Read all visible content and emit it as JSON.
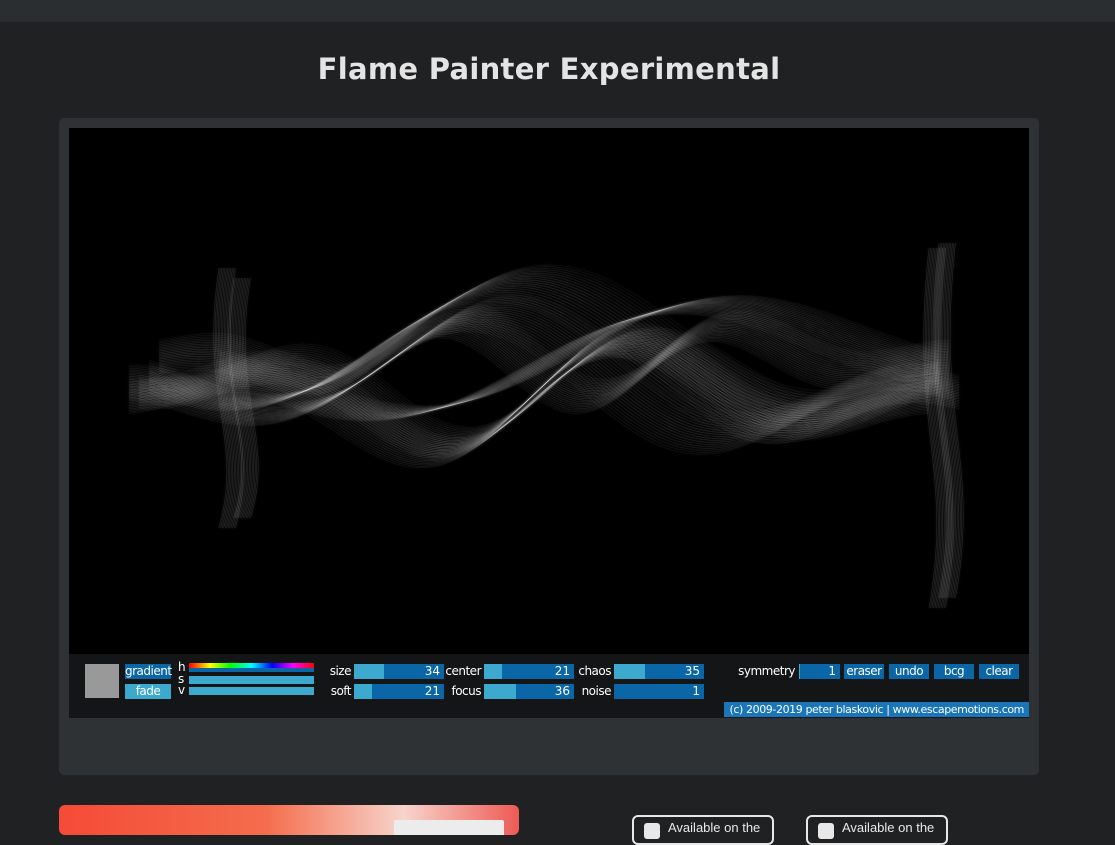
{
  "page": {
    "title": "Flame Painter Experimental"
  },
  "toolbar": {
    "color_swatch": "#999999",
    "gradient_label": "gradient",
    "fade_label": "fade",
    "hsv_labels": {
      "h": "h",
      "s": "s",
      "v": "v"
    },
    "sliders": {
      "size": {
        "label": "size",
        "value": "34",
        "fraction": 0.33
      },
      "soft": {
        "label": "soft",
        "value": "21",
        "fraction": 0.2
      },
      "center": {
        "label": "center",
        "value": "21",
        "fraction": 0.2
      },
      "focus": {
        "label": "focus",
        "value": "36",
        "fraction": 0.35
      },
      "chaos": {
        "label": "chaos",
        "value": "35",
        "fraction": 0.34
      },
      "noise": {
        "label": "noise",
        "value": "1",
        "fraction": 0.0
      }
    },
    "symmetry": {
      "label": "symmetry",
      "value": "1"
    },
    "buttons": {
      "eraser": "eraser",
      "undo": "undo",
      "bcg": "bcg",
      "clear": "clear"
    },
    "copyright": "(c) 2009-2019 peter blaskovic | www.escapemotions.com"
  },
  "footer": {
    "badge1": "Available on the",
    "badge2": "Available on the"
  },
  "colors": {
    "accent_light": "#3ea9cf",
    "accent_dark": "#0a66a6",
    "background": "#1f2123",
    "panel": "#2f3235"
  }
}
